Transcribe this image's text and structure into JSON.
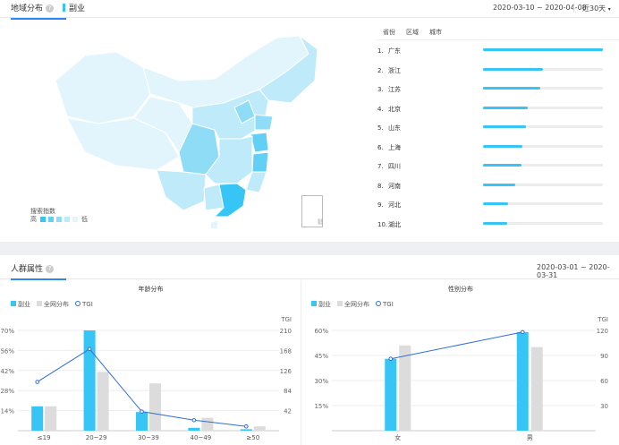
{
  "region": {
    "tabs": [
      {
        "label": "地域分布",
        "active": true
      },
      {
        "label": "副业",
        "active": false
      }
    ],
    "date_range": "2020-03-10 ~ 2020-04-08",
    "period": "近30天",
    "subtabs": [
      "省份",
      "区域",
      "城市"
    ],
    "map_legend": {
      "title": "搜索指数",
      "high": "高",
      "low": "低",
      "colors": [
        "#36c5f4",
        "#62d0f5",
        "#8fdcf7",
        "#bfeafa",
        "#e3f5fc"
      ]
    },
    "inset_label": "南海诸岛",
    "ranking": [
      {
        "rank": "1.",
        "name": "广东",
        "value": 1.0
      },
      {
        "rank": "2.",
        "name": "浙江",
        "value": 0.5
      },
      {
        "rank": "3.",
        "name": "江苏",
        "value": 0.48
      },
      {
        "rank": "4.",
        "name": "北京",
        "value": 0.37
      },
      {
        "rank": "5.",
        "name": "山东",
        "value": 0.36
      },
      {
        "rank": "6.",
        "name": "上海",
        "value": 0.33
      },
      {
        "rank": "7.",
        "name": "四川",
        "value": 0.32
      },
      {
        "rank": "8.",
        "name": "河南",
        "value": 0.27
      },
      {
        "rank": "9.",
        "name": "河北",
        "value": 0.21
      },
      {
        "rank": "10.",
        "name": "湖北",
        "value": 0.2
      }
    ]
  },
  "crowd": {
    "title": "人群属性",
    "date_range": "2020-03-01 ~ 2020-03-31",
    "legend": {
      "series_a": "副业",
      "series_b": "全网分布",
      "series_c": "TGI"
    },
    "colors": {
      "a": "#36c5f4",
      "b": "#dcdcdc",
      "tgi": "#2e6fd6"
    }
  },
  "chart_data": [
    {
      "type": "bar",
      "title": "年龄分布",
      "categories": [
        "≤19",
        "20~29",
        "30~39",
        "40~49",
        "≥50"
      ],
      "series": [
        {
          "name": "副业",
          "values": [
            0.17,
            0.7,
            0.13,
            0.02,
            0.01
          ]
        },
        {
          "name": "全网分布",
          "values": [
            0.17,
            0.41,
            0.33,
            0.09,
            0.03
          ]
        },
        {
          "name": "TGI",
          "values": [
            102,
            171,
            40,
            22,
            9
          ]
        }
      ],
      "y_ticks": [
        "14%",
        "28%",
        "42%",
        "56%",
        "70%"
      ],
      "y2_label": "TGI",
      "y2_ticks": [
        "42",
        "84",
        "126",
        "168",
        "210"
      ],
      "ylim": [
        0,
        0.7
      ],
      "y2lim": [
        0,
        210
      ]
    },
    {
      "type": "bar",
      "title": "性别分布",
      "categories": [
        "女",
        "男"
      ],
      "series": [
        {
          "name": "副业",
          "values": [
            0.43,
            0.59
          ]
        },
        {
          "name": "全网分布",
          "values": [
            0.51,
            0.5
          ]
        },
        {
          "name": "TGI",
          "values": [
            86,
            118
          ]
        }
      ],
      "y_ticks": [
        "15%",
        "30%",
        "45%",
        "60%"
      ],
      "y2_label": "TGI",
      "y2_ticks": [
        "30",
        "60",
        "90",
        "120"
      ],
      "ylim": [
        0,
        0.6
      ],
      "y2lim": [
        0,
        120
      ]
    }
  ]
}
